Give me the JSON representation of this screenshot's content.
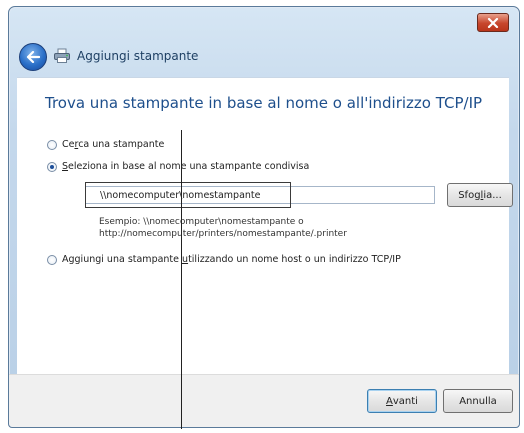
{
  "window": {
    "title": "Aggiungi stampante",
    "close_icon": "close-icon",
    "back_icon": "back-arrow-icon",
    "printer_icon": "printer-icon"
  },
  "main": {
    "heading": "Trova una stampante in base al nome o all'indirizzo TCP/IP",
    "options": [
      {
        "pre": "Ce",
        "accel": "r",
        "post": "ca una stampante",
        "checked": false
      },
      {
        "pre": "",
        "accel": "S",
        "post": "eleziona in base al nome una stampante condivisa",
        "checked": true
      },
      {
        "pre": "Aggiungi una stampante ",
        "accel": "u",
        "post": "tilizzando un nome host o un indirizzo TCP/IP",
        "checked": false
      }
    ],
    "share_input_value": "\\\\nomecomputer\\nomestampante",
    "browse_label_pre": "Sfog",
    "browse_label_accel": "l",
    "browse_label_post": "ia...",
    "example_line1": "Esempio: \\\\nomecomputer\\nomestampante o",
    "example_line2": "http://nomecomputer/printers/nomestampante/.printer"
  },
  "footer": {
    "next_accel": "A",
    "next_post": "vanti",
    "cancel_label": "Annulla"
  },
  "colors": {
    "heading": "#1e4f8c",
    "close_button": "#c7462c",
    "back_button": "#2a6fc8"
  }
}
